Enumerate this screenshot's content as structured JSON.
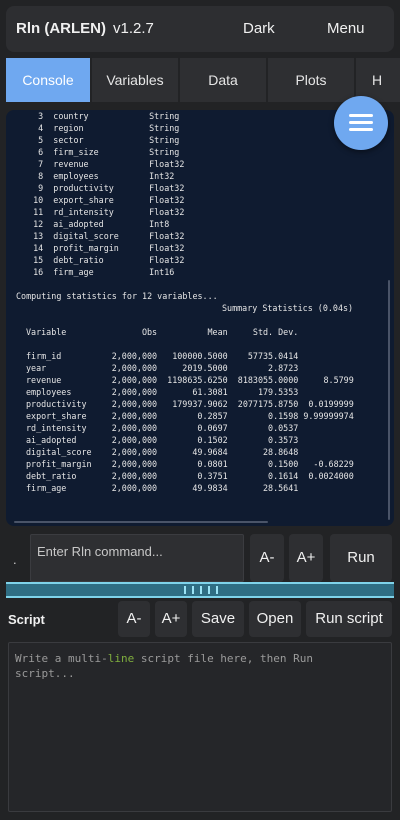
{
  "header": {
    "title": "Rln (ARLEN)",
    "version": "v1.2.7",
    "dark_label": "Dark",
    "menu_label": "Menu"
  },
  "tabs": [
    {
      "label": "Console",
      "active": true
    },
    {
      "label": "Variables",
      "active": false
    },
    {
      "label": "Data",
      "active": false
    },
    {
      "label": "Plots",
      "active": false
    },
    {
      "label": "H",
      "active": false
    }
  ],
  "console": {
    "variables": [
      [
        "3",
        "country",
        "String"
      ],
      [
        "4",
        "region",
        "String"
      ],
      [
        "5",
        "sector",
        "String"
      ],
      [
        "6",
        "firm_size",
        "String"
      ],
      [
        "7",
        "revenue",
        "Float32"
      ],
      [
        "8",
        "employees",
        "Int32"
      ],
      [
        "9",
        "productivity",
        "Float32"
      ],
      [
        "10",
        "export_share",
        "Float32"
      ],
      [
        "11",
        "rd_intensity",
        "Float32"
      ],
      [
        "12",
        "ai_adopted",
        "Int8"
      ],
      [
        "13",
        "digital_score",
        "Float32"
      ],
      [
        "14",
        "profit_margin",
        "Float32"
      ],
      [
        "15",
        "debt_ratio",
        "Float32"
      ],
      [
        "16",
        "firm_age",
        "Int16"
      ]
    ],
    "computing_line": "Computing statistics for 12 variables...",
    "summary_title": "Summary Statistics (0.04s)",
    "stats_headers": [
      "Variable",
      "Obs",
      "Mean",
      "Std. Dev.",
      ""
    ],
    "stats_rows": [
      [
        "firm_id",
        "2,000,000",
        "100000.5000",
        "57735.0414",
        ""
      ],
      [
        "year",
        "2,000,000",
        "2019.5000",
        "2.8723",
        ""
      ],
      [
        "revenue",
        "2,000,000",
        "1198635.6250",
        "8183055.0000",
        "8.5799"
      ],
      [
        "employees",
        "2,000,000",
        "61.3081",
        "179.5353",
        ""
      ],
      [
        "productivity",
        "2,000,000",
        "179937.9062",
        "2077175.8750",
        "0.0199999"
      ],
      [
        "export_share",
        "2,000,000",
        "0.2857",
        "0.1598",
        "9.99999974"
      ],
      [
        "rd_intensity",
        "2,000,000",
        "0.0697",
        "0.0537",
        ""
      ],
      [
        "ai_adopted",
        "2,000,000",
        "0.1502",
        "0.3573",
        ""
      ],
      [
        "digital_score",
        "2,000,000",
        "49.9684",
        "28.8648",
        ""
      ],
      [
        "profit_margin",
        "2,000,000",
        "0.0801",
        "0.1500",
        "-0.68229"
      ],
      [
        "debt_ratio",
        "2,000,000",
        "0.3751",
        "0.1614",
        "0.0024000"
      ],
      [
        "firm_age",
        "2,000,000",
        "49.9834",
        "28.5641",
        ""
      ]
    ]
  },
  "command": {
    "prompt": ".",
    "placeholder": "Enter Rln command...",
    "font_down": "A-",
    "font_up": "A+",
    "run": "Run"
  },
  "script": {
    "label": "Script",
    "font_down": "A-",
    "font_up": "A+",
    "save": "Save",
    "open": "Open",
    "run_script": "Run script",
    "placeholder_before": "Write a multi-",
    "placeholder_keyword": "line",
    "placeholder_after": " script file here, then Run script..."
  },
  "colors": {
    "accent": "#6fa8f0",
    "console_bg": "#0f1b30",
    "splitter": "#2f6e84",
    "keyword": "#7fae3e"
  },
  "icons": {
    "fab": "menu-icon",
    "splitter": "drag-grip-icon"
  }
}
